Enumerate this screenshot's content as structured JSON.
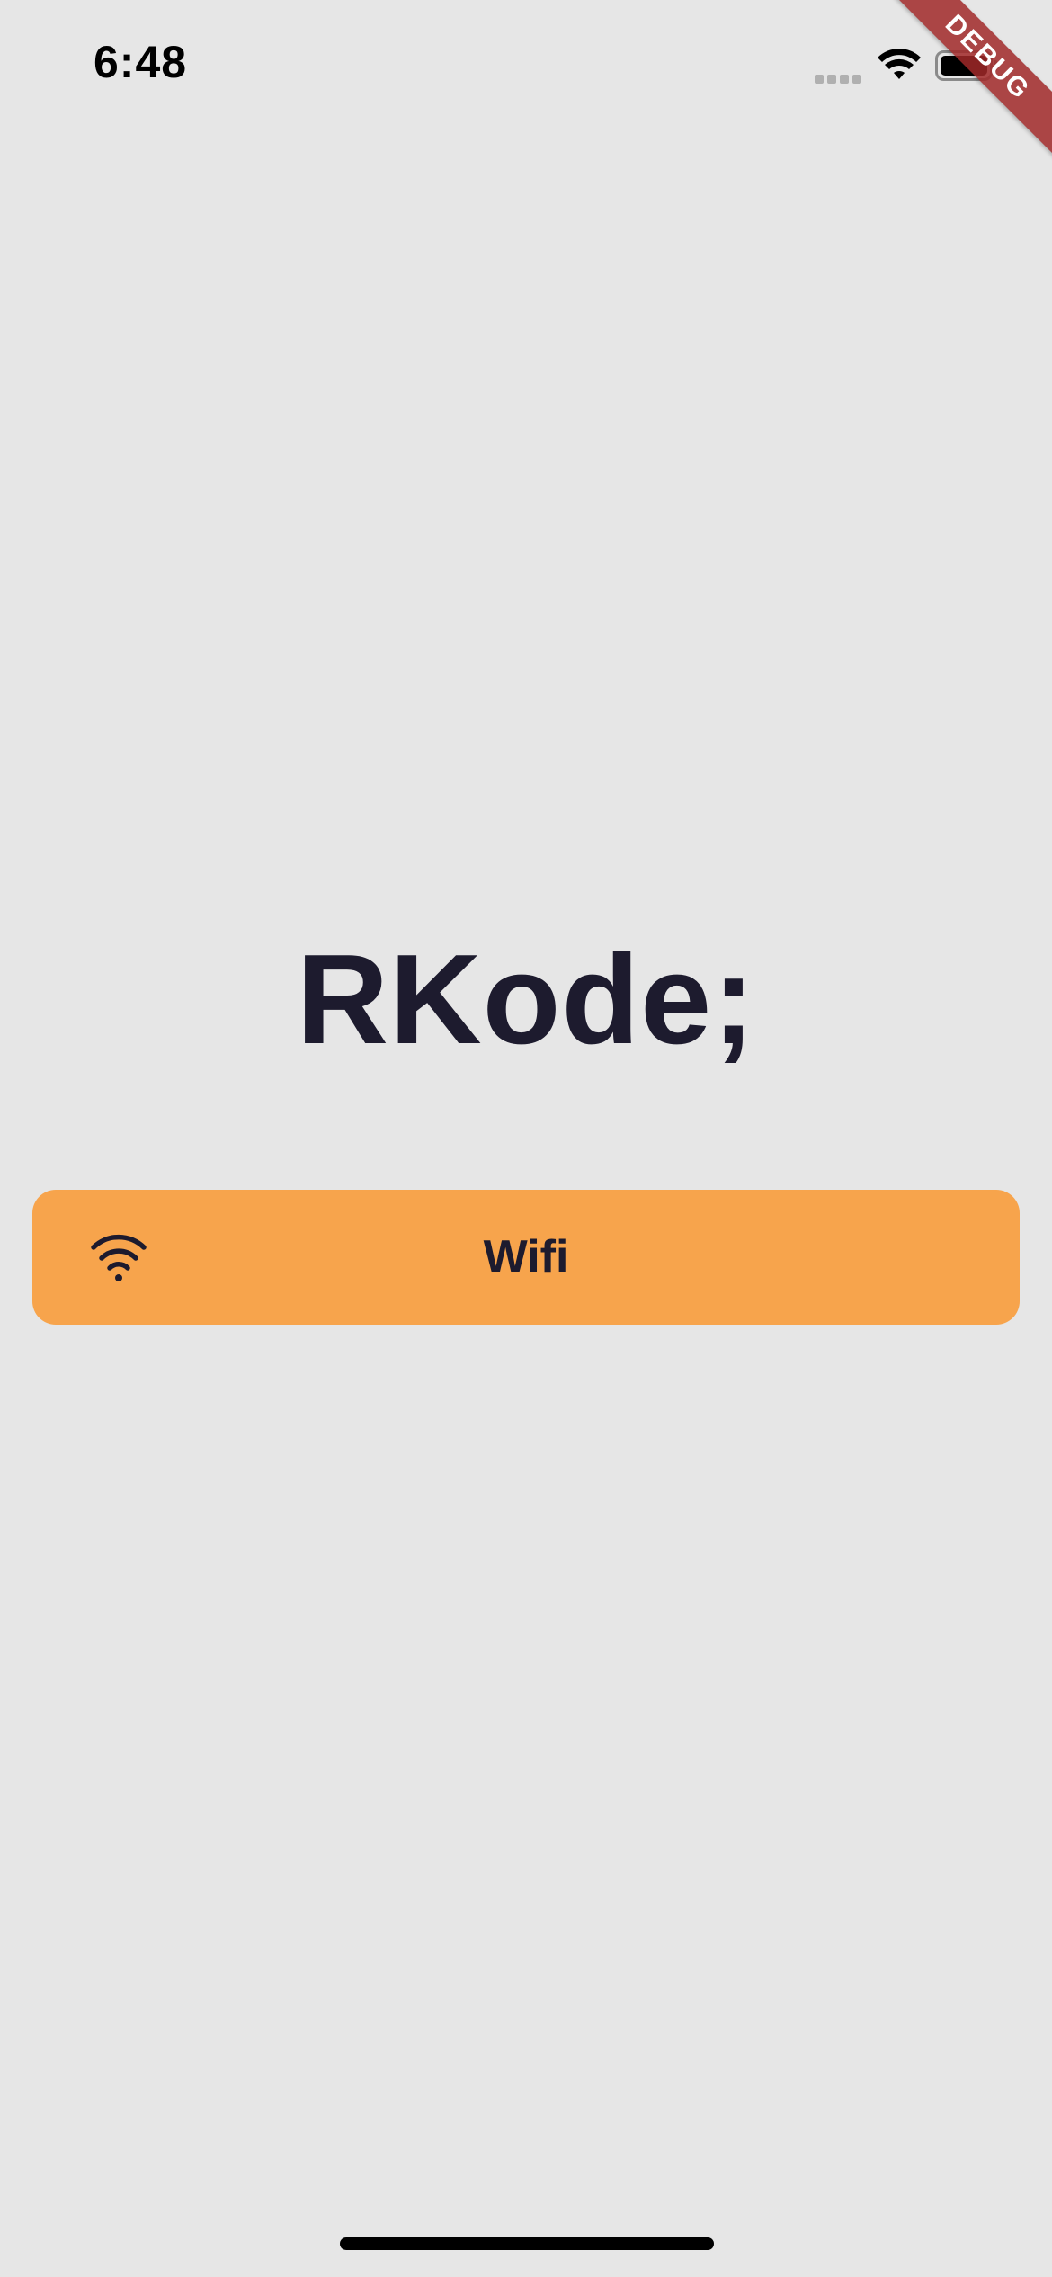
{
  "status_bar": {
    "time": "6:48",
    "icons": [
      "cellular-signal-icon",
      "wifi-icon",
      "battery-icon"
    ]
  },
  "debug_banner": {
    "label": "DEBUG",
    "color": "#a02828"
  },
  "app": {
    "title": "RKode;"
  },
  "wifi_button": {
    "label": "Wifi",
    "icon": "wifi-icon",
    "background": "#f7a44c"
  },
  "colors": {
    "background": "#e6e6e6",
    "text": "#1d1b2e"
  }
}
